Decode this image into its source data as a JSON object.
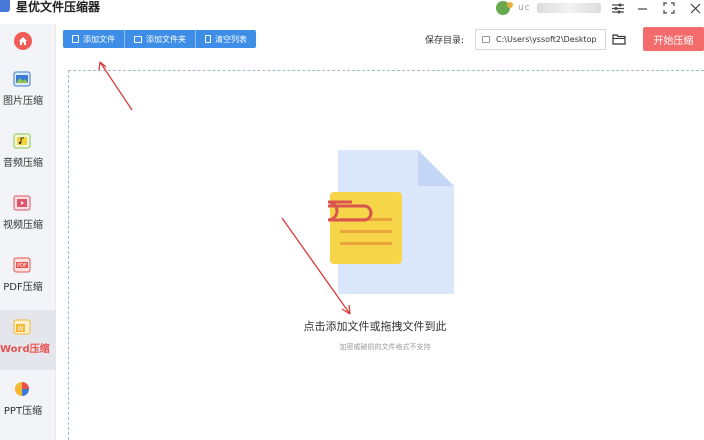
{
  "window": {
    "title": "星优文件压缩器",
    "user_name": "uc",
    "controls": [
      "settings-icon",
      "minimize-icon",
      "maximize-icon",
      "close-icon"
    ]
  },
  "sidebar": {
    "home_icon": "home-icon",
    "items": [
      {
        "label": "图片压缩",
        "icon": "image-icon",
        "color": "#3a7bd5",
        "active": false
      },
      {
        "label": "音频压缩",
        "icon": "audio-icon",
        "color": "#8fc34a",
        "active": false
      },
      {
        "label": "视频压缩",
        "icon": "video-icon",
        "color": "#e0556a",
        "active": false
      },
      {
        "label": "PDF压缩",
        "icon": "pdf-icon",
        "color": "#e8534f",
        "active": false
      },
      {
        "label": "Word压缩",
        "icon": "word-icon",
        "color": "#f5b731",
        "active": true
      },
      {
        "label": "PPT压缩",
        "icon": "ppt-icon",
        "color": "#e8534f",
        "active": false
      }
    ]
  },
  "toolbar": {
    "add_file": "添加文件",
    "add_folder": "添加文件夹",
    "clear_list": "清空列表"
  },
  "output": {
    "save_label": "保存目录:",
    "save_path": "C:\\Users\\yssoft2\\Desktop",
    "start_button": "开始压缩"
  },
  "dropzone": {
    "hint": "点击添加文件或拖拽文件到此",
    "subhint": "加密或破损的文件格式不支持"
  },
  "colors": {
    "accent_blue": "#3e8ee8",
    "start_red": "#f36b6b",
    "active_red": "#e8534f"
  }
}
